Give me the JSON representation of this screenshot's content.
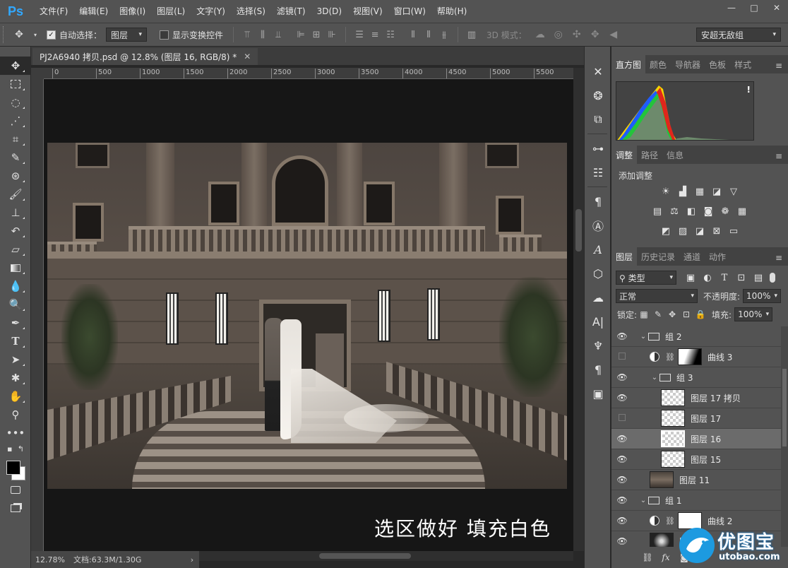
{
  "app": {
    "logo": "Ps"
  },
  "menu": [
    "文件(F)",
    "编辑(E)",
    "图像(I)",
    "图层(L)",
    "文字(Y)",
    "选择(S)",
    "滤镜(T)",
    "3D(D)",
    "视图(V)",
    "窗口(W)",
    "帮助(H)"
  ],
  "window_controls": {
    "minimize": "—",
    "maximize": "□",
    "close": "✕"
  },
  "options": {
    "auto_select_label": "自动选择：",
    "auto_select_checked": true,
    "auto_select_target": "图层",
    "show_transform_label": "显示变换控件",
    "show_transform_checked": false,
    "mode_3d_label": "3D 模式：",
    "workspace": "安超无敌组"
  },
  "document": {
    "tab_title": "PJ2A6940 拷贝.psd @ 12.8% (图层 16, RGB/8) *",
    "ruler_marks": [
      "0",
      "500",
      "1000",
      "1500",
      "2000",
      "2500",
      "3000",
      "3500",
      "4000",
      "4500",
      "5000",
      "5500"
    ],
    "caption": "选区做好 填充白色",
    "zoom": "12.78%",
    "doc_size": "文档:63.3M/1.30G"
  },
  "panels": {
    "histogram_tabs": [
      "直方图",
      "颜色",
      "导航器",
      "色板",
      "样式"
    ],
    "histogram_warning": "!",
    "adjust_tabs": [
      "调整",
      "路径",
      "信息"
    ],
    "adjust_title": "添加调整",
    "layers_tabs": [
      "图层",
      "历史记录",
      "通道",
      "动作"
    ],
    "filter_kind": "类型",
    "blend_mode": "正常",
    "opacity_label": "不透明度:",
    "opacity_value": "100%",
    "lock_label": "锁定:",
    "fill_label": "填充:",
    "fill_value": "100%"
  },
  "layers": [
    {
      "name": "组 2",
      "type": "group",
      "visible": true,
      "indent": 0,
      "expanded": true
    },
    {
      "name": "曲线 3",
      "type": "adjustment",
      "visible": false,
      "indent": 1
    },
    {
      "name": "组 3",
      "type": "group",
      "visible": true,
      "indent": 1,
      "expanded": true
    },
    {
      "name": "图层 17 拷贝",
      "type": "pixel",
      "visible": true,
      "indent": 2
    },
    {
      "name": "图层 17",
      "type": "pixel",
      "visible": false,
      "indent": 2
    },
    {
      "name": "图层 16",
      "type": "pixel",
      "visible": true,
      "indent": 2,
      "selected": true
    },
    {
      "name": "图层 15",
      "type": "pixel",
      "visible": true,
      "indent": 2
    },
    {
      "name": "图层 11",
      "type": "photo",
      "visible": true,
      "indent": 1
    },
    {
      "name": "组 1",
      "type": "group",
      "visible": true,
      "indent": 0,
      "expanded": true
    },
    {
      "name": "曲线 2",
      "type": "adjustment-white",
      "visible": true,
      "indent": 1
    },
    {
      "name": "图层",
      "type": "photo-dark",
      "visible": true,
      "indent": 1
    }
  ],
  "watermark": {
    "name": "优图宝",
    "url": "utobao.com"
  }
}
